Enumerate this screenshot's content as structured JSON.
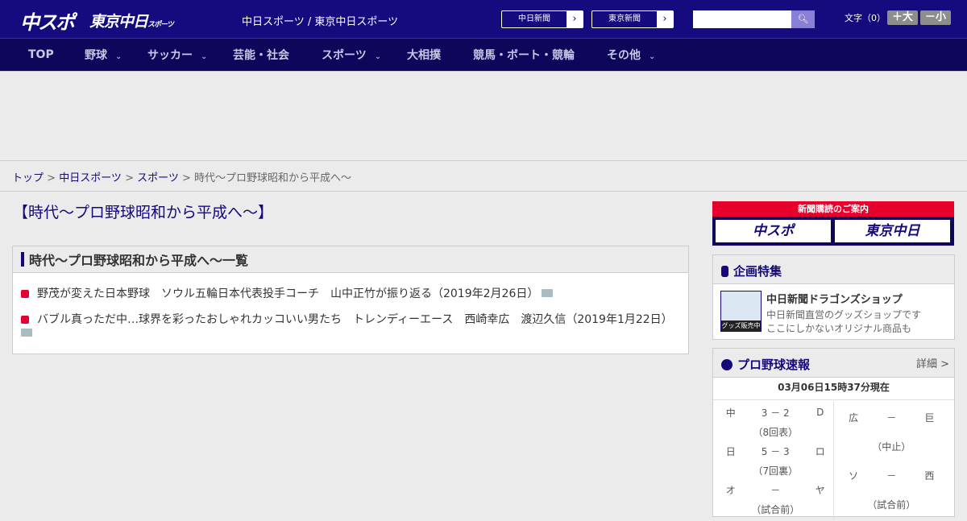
{
  "header": {
    "logo_chuspo": "中スポ",
    "logo_tokyo": "東京中日",
    "logo_tokyo_sub": "スポーツ",
    "tagline": "中日スポーツ / 東京中日スポーツ",
    "paper_links": [
      "中日新聞",
      "東京新聞"
    ],
    "search_placeholder": "",
    "font_label": "文字（0）",
    "font_larger": "＋大",
    "font_smaller": "－小"
  },
  "nav": [
    "TOP",
    "野球",
    "サッカー",
    "芸能・社会",
    "スポーツ",
    "大相撲",
    "競馬・ボート・競輪",
    "その他"
  ],
  "breadcrumb": {
    "items": [
      "トップ",
      "中日スポーツ",
      "スポーツ"
    ],
    "current": "時代～プロ野球昭和から平成へ～",
    "sep": " > "
  },
  "page_title": "【時代～プロ野球昭和から平成へ～】",
  "list": {
    "heading": "時代～プロ野球昭和から平成へ～一覧",
    "items": [
      {
        "text": "野茂が変えた日本野球　ソウル五輪日本代表投手コーチ　山中正竹が振り返る（2019年2月26日）"
      },
      {
        "text": "バブル真っただ中…球界を彩ったおしゃれカッコいい男たち　トレンディーエース　西崎幸広　渡辺久信（2019年1月22日）"
      }
    ]
  },
  "subscribe": {
    "label": "新聞購読のご案内",
    "a": "中スポ",
    "b": "東京中日"
  },
  "feature": {
    "heading": "企画特集",
    "img_label": "グッズ販売中",
    "title": "中日新聞ドラゴンズショップ",
    "line1": "中日新聞直営のグッズショップです",
    "line2": "ここにしかないオリジナル商品も"
  },
  "baseball": {
    "heading": "プロ野球速報",
    "detail": "詳細 >",
    "updated": "03月06日15時37分現在",
    "left": [
      {
        "home": "中",
        "score": "3 － 2",
        "away": "D",
        "status": "（8回表）"
      },
      {
        "home": "日",
        "score": "5 － 3",
        "away": "ロ",
        "status": "（7回裏）"
      },
      {
        "home": "オ",
        "score": "－",
        "away": "ヤ",
        "status": "（試合前）"
      }
    ],
    "right": [
      {
        "home": "広",
        "score": "－",
        "away": "巨",
        "status": "（中止）"
      },
      {
        "home": "ソ",
        "score": "－",
        "away": "西",
        "status": "（試合前）"
      }
    ]
  }
}
